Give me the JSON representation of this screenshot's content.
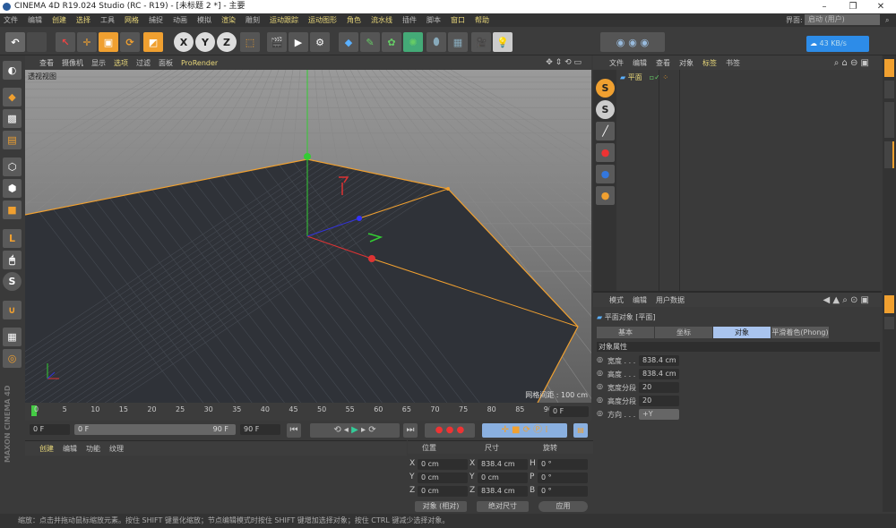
{
  "window": {
    "title": "CINEMA 4D R19.024 Studio (RC - R19) - [未标题 2 *] - 主要",
    "minimize": "–",
    "maximize": "❐",
    "close": "✕"
  },
  "menu": [
    "文件",
    "编辑",
    "创建",
    "选择",
    "工具",
    "网格",
    "捕捉",
    "动画",
    "模拟",
    "渲染",
    "雕刻",
    "运动跟踪",
    "运动图形",
    "角色",
    "流水线",
    "插件",
    "脚本",
    "窗口",
    "帮助"
  ],
  "layout": {
    "label": "界面:",
    "value": "启动 (用户)"
  },
  "network_badge": {
    "speed": "43 KB/s"
  },
  "toolbar": {
    "axis_x": "X",
    "axis_y": "Y",
    "axis_z": "Z"
  },
  "viewport": {
    "menu": [
      "查看",
      "摄像机",
      "显示",
      "选项",
      "过滤",
      "面板",
      "ProRender"
    ],
    "view_name": "透视视图",
    "grid_spacing": "网格间距 : 100 cm"
  },
  "object_manager": {
    "menu": [
      "文件",
      "编辑",
      "查看",
      "对象",
      "标签",
      "书签"
    ],
    "objects": [
      {
        "name": "平面"
      }
    ]
  },
  "attributes": {
    "menu": [
      "模式",
      "编辑",
      "用户数据"
    ],
    "object_title": "平面对象 [平面]",
    "tabs": [
      "基本",
      "坐标",
      "对象",
      "平滑着色(Phong)"
    ],
    "active_tab": "对象",
    "section": "对象属性",
    "fields": [
      {
        "label": "宽度 . . .",
        "value": "838.4 cm"
      },
      {
        "label": "高度 . . .",
        "value": "838.4 cm"
      },
      {
        "label": "宽度分段",
        "value": "20"
      },
      {
        "label": "高度分段",
        "value": "20"
      },
      {
        "label": "方向 . . .",
        "value": "+Y"
      }
    ]
  },
  "timeline": {
    "ticks": [
      "0",
      "5",
      "10",
      "15",
      "20",
      "25",
      "30",
      "35",
      "40",
      "45",
      "50",
      "55",
      "60",
      "65",
      "70",
      "75",
      "80",
      "85",
      "90"
    ],
    "current": "0 F",
    "start": "0 F",
    "range_start": "0 F",
    "range_end": "90 F",
    "end": "90 F"
  },
  "materials": {
    "menu": [
      "创建",
      "编辑",
      "功能",
      "纹理"
    ]
  },
  "coordinates": {
    "headers": [
      "位置",
      "尺寸",
      "旋转"
    ],
    "rows": [
      {
        "pa": "X",
        "pv": "0 cm",
        "sa": "X",
        "sv": "838.4 cm",
        "ra": "H",
        "rv": "0 °"
      },
      {
        "pa": "Y",
        "pv": "0 cm",
        "sa": "Y",
        "sv": "0 cm",
        "ra": "P",
        "rv": "0 °"
      },
      {
        "pa": "Z",
        "pv": "0 cm",
        "sa": "Z",
        "sv": "838.4 cm",
        "ra": "B",
        "rv": "0 °"
      }
    ],
    "mode": "对象 (相对)",
    "size_mode": "绝对尺寸",
    "apply": "应用"
  },
  "brand": "MAXON CINEMA 4D",
  "status": "缩放：点击并拖动鼠标缩放元素。按住 SHIFT 键量化缩放；节点编辑模式时按住 SHIFT 键增加选择对象；按住 CTRL 键减少选择对象。",
  "colors": {
    "accent_orange": "#f0a030",
    "highlight_menu": "#e8d77a",
    "active_tab": "#a9c4ee"
  }
}
